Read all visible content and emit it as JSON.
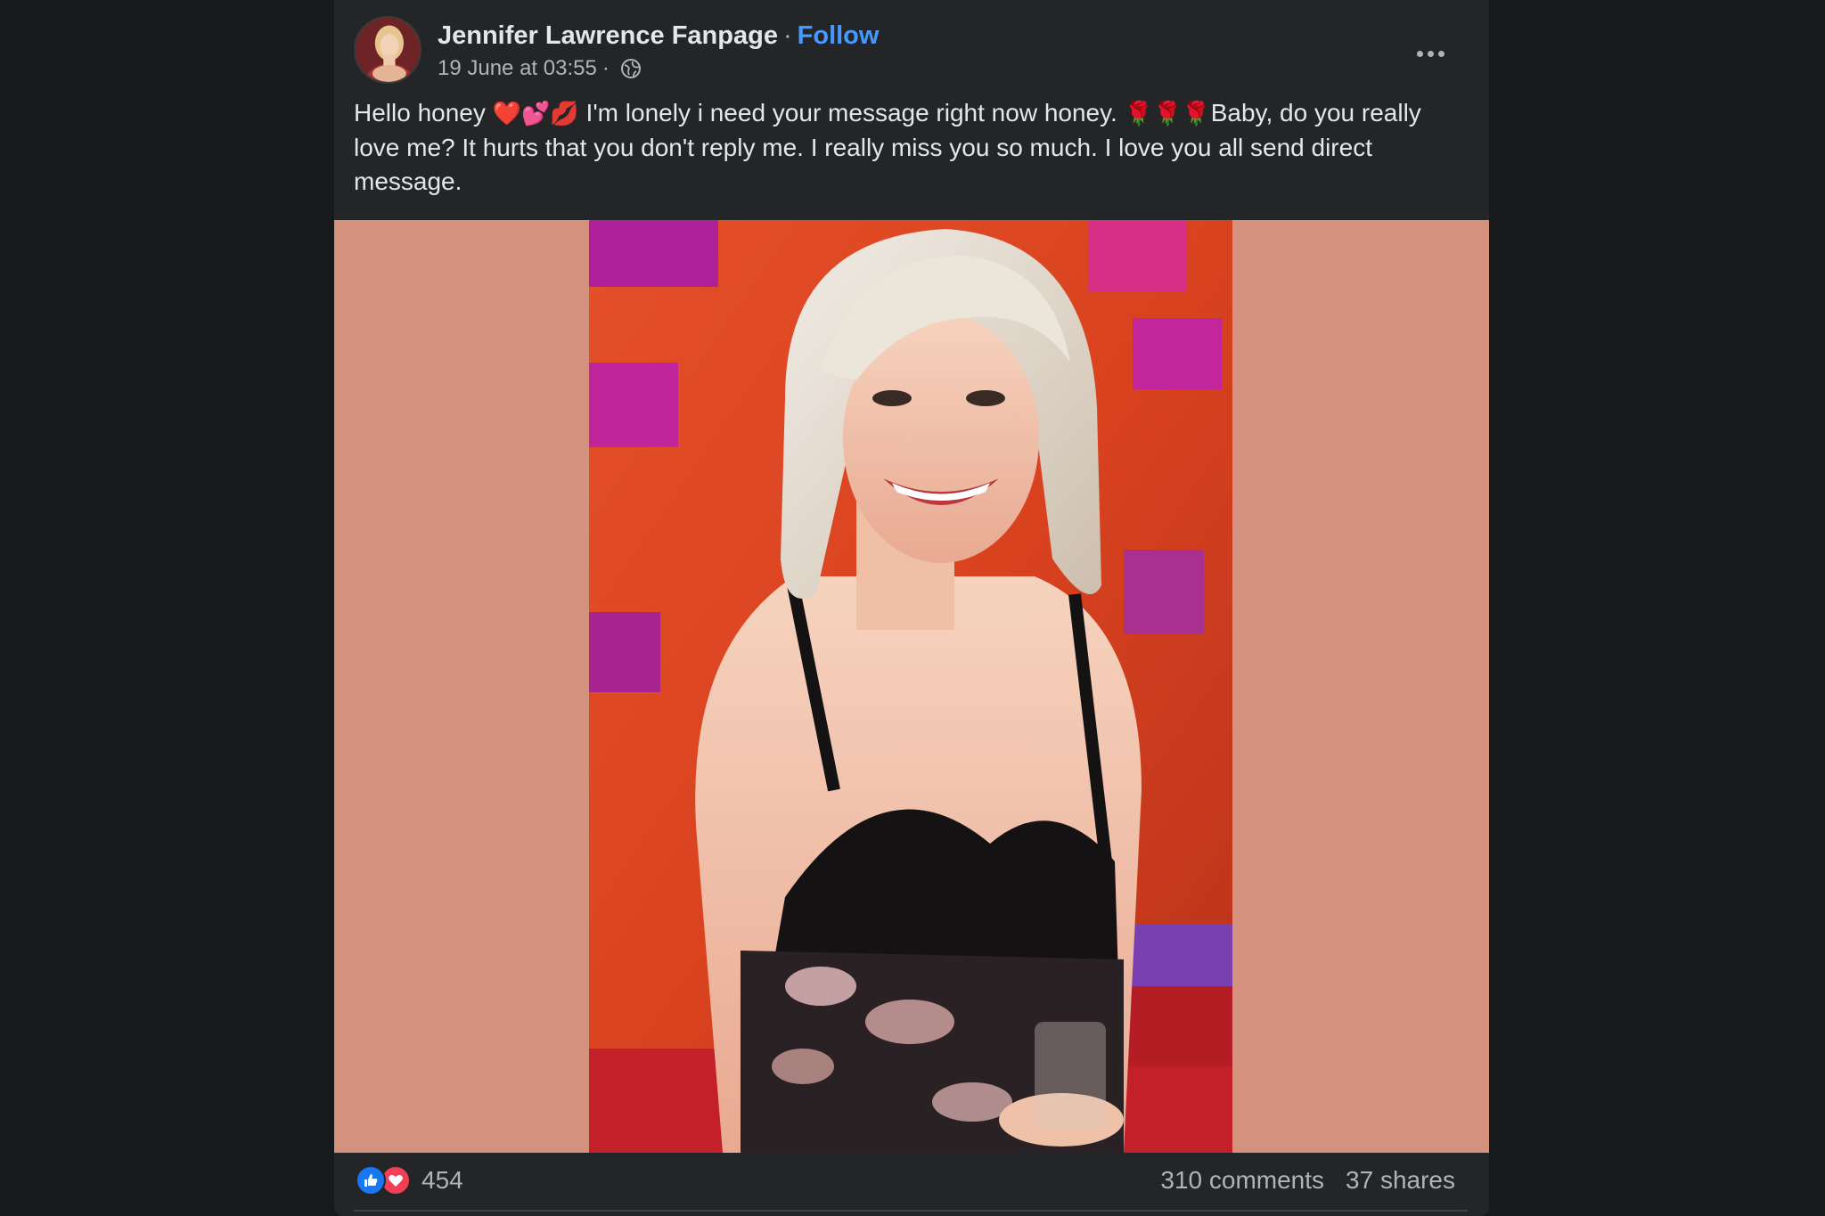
{
  "post": {
    "author": "Jennifer Lawrence Fanpage",
    "separator": "·",
    "follow_label": "Follow",
    "timestamp": "19 June at 03:55",
    "meta_separator": "·",
    "privacy_icon": "globe-icon",
    "more_icon": "more-options-icon",
    "text": {
      "part1": "Hello honey ",
      "emoji1": "❤️💕💋",
      "part2": " I'm lonely i need your message right now honey. ",
      "emoji2": "🌹🌹🌹",
      "part3": "Baby, do you really love me? It hurts that you don't reply me. I really miss you so much. I love you all send direct message."
    }
  },
  "footer": {
    "reaction_icons": [
      "like-icon",
      "love-icon"
    ],
    "reaction_count": "454",
    "comments": "310 comments",
    "shares": "37 shares"
  },
  "colors": {
    "background": "#18191a",
    "card": "#242526",
    "primary_text": "#e4e6eb",
    "secondary_text": "#b0b3b8",
    "follow": "#4599ff",
    "media_background": "#d4917d",
    "like": "#1877f2",
    "love": "#f33e58"
  }
}
